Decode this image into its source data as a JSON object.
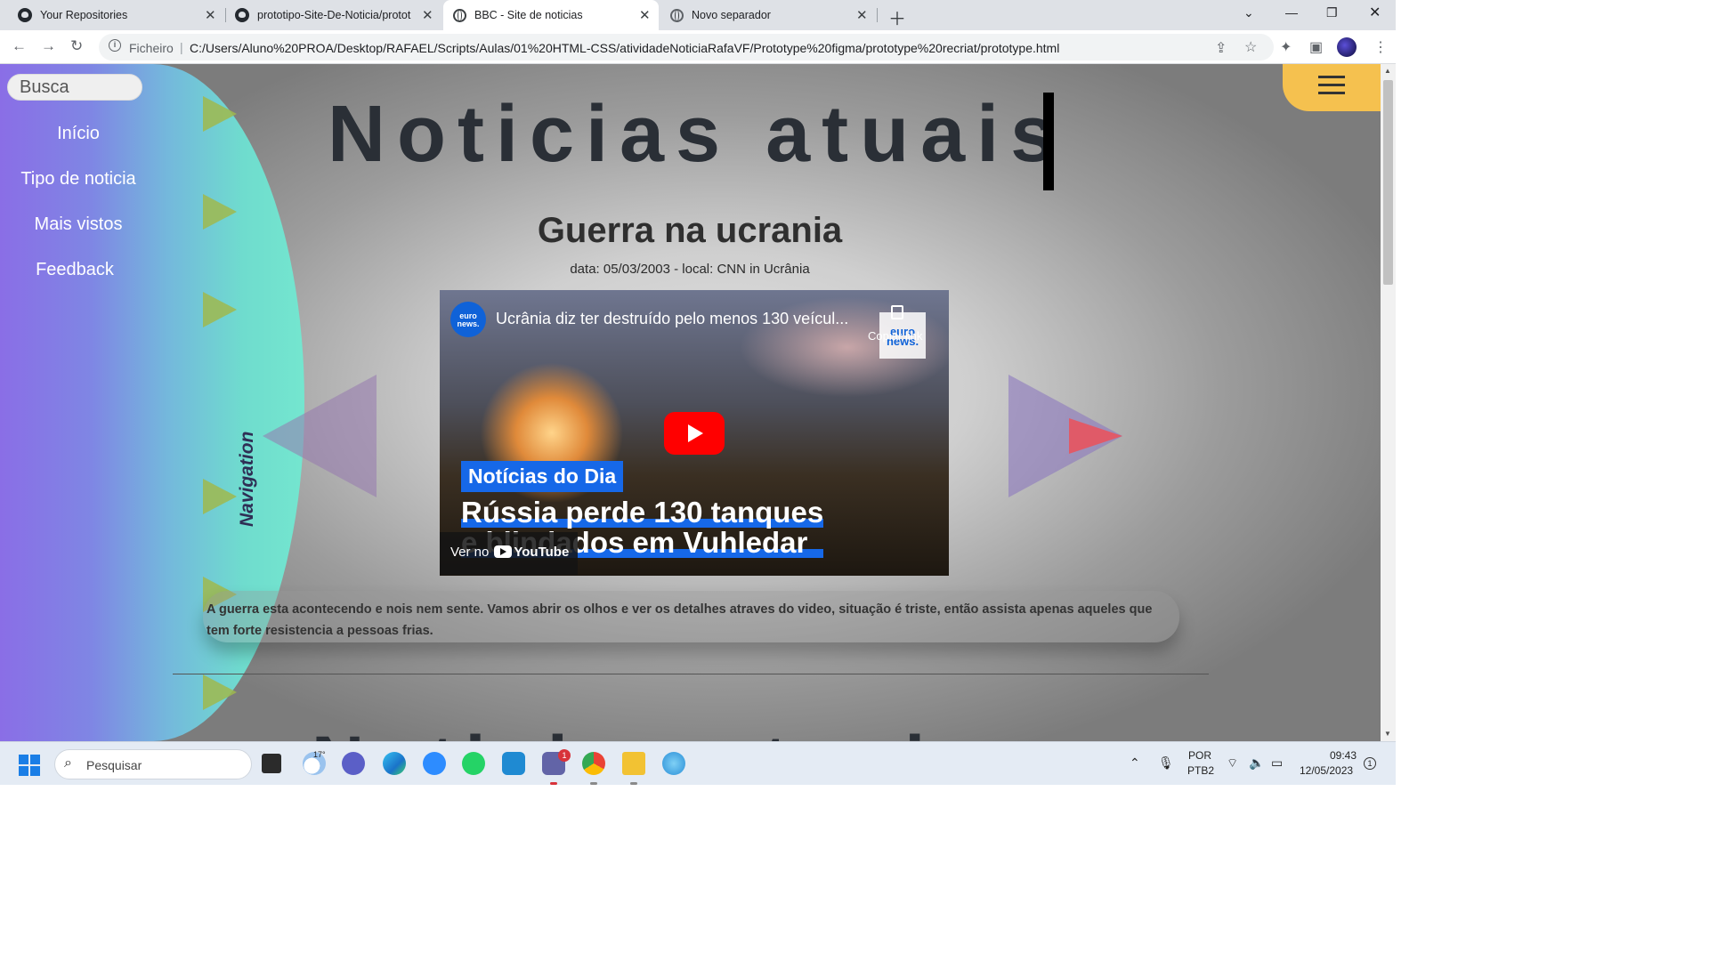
{
  "browser": {
    "tabs": [
      {
        "title": "Your Repositories",
        "icon": "github-icon"
      },
      {
        "title": "prototipo-Site-De-Noticia/protot",
        "icon": "github-icon"
      },
      {
        "title": "BBC - Site de noticias",
        "icon": "globe-icon",
        "active": true
      },
      {
        "title": "Novo separador",
        "icon": "chrome-icon"
      }
    ],
    "scheme_label": "Ficheiro",
    "url": "C:/Users/Aluno%20PROA/Desktop/RAFAEL/Scripts/Aulas/01%20HTML-CSS/atividadeNoticiaRafaVF/Prototype%20figma/prototype%20recriat/prototype.html"
  },
  "sidebar": {
    "search_placeholder": "Busca",
    "links": [
      "Início",
      "Tipo de noticia",
      "Mais vistos",
      "Feedback"
    ],
    "vertical_label": "Navigation",
    "accent_colors": [
      "#8a6ee6",
      "#74e6cf"
    ]
  },
  "page": {
    "title": "Noticias atuais",
    "news": {
      "headline": "Guerra na ucrania",
      "meta": "data: 05/03/2003 - local: CNN in Ucrânia",
      "video": {
        "channel_logo": "euro news.",
        "title": "Ucrânia diz ter destruído pelo menos 130 veícul...",
        "copy_link": "Copiar link",
        "tag": "Notícias do Dia",
        "headline_line1": "Rússia perde 130 tanques",
        "headline_line2": "e blindados em Vuhledar",
        "watch_on": "Ver no",
        "platform": "YouTube"
      },
      "description": "A guerra esta acontecendo e nois nem sente. Vamos abrir os olhos e ver os detalhes atraves do video, situação é triste, então assista apenas aqueles que tem forte resistencia a pessoas frias."
    },
    "next_title": "Noticias atuais",
    "menu_button_color": "#f5c14f"
  },
  "taskbar": {
    "search_label": "Pesquisar",
    "weather_temp": "17°",
    "teams_badge": "1",
    "language": "POR",
    "keyboard": "PTB2",
    "time": "09:43",
    "date": "12/05/2023",
    "notification_count": "1"
  }
}
